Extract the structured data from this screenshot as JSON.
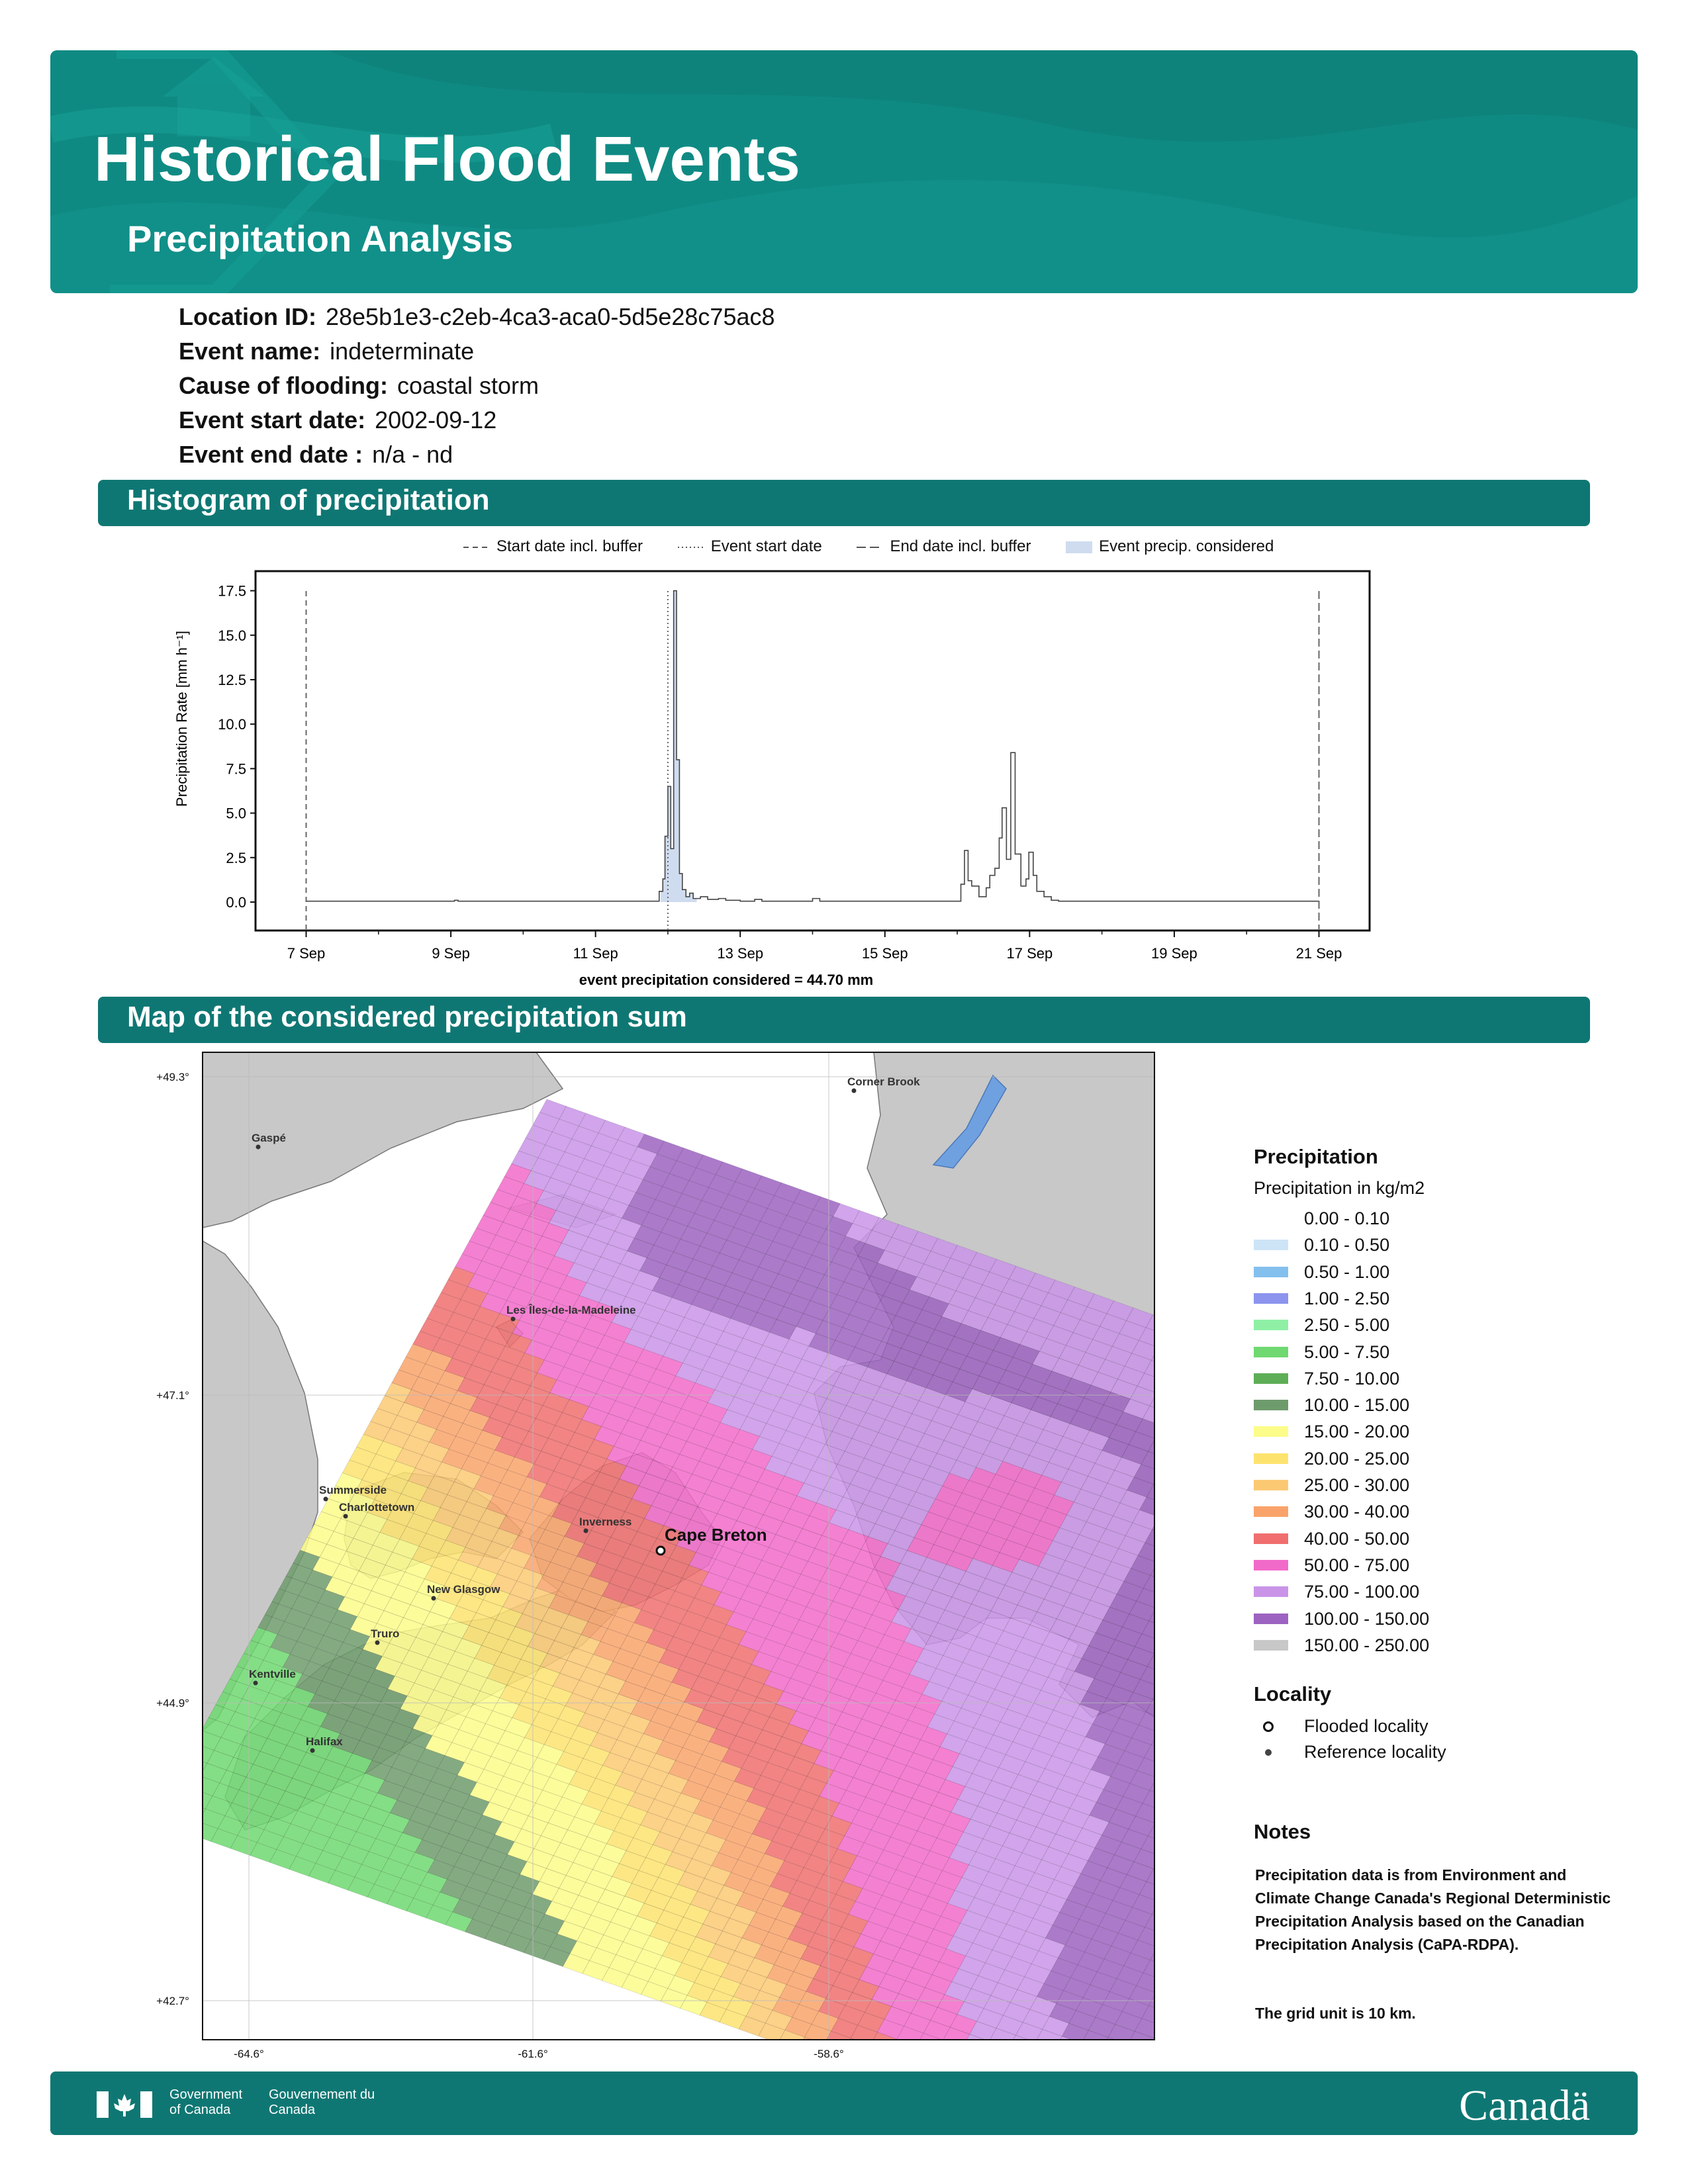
{
  "header": {
    "title": "Historical Flood Events",
    "subtitle": "Precipitation Analysis"
  },
  "info": [
    {
      "label": "Location ID:",
      "value": "28e5b1e3-c2eb-4ca3-aca0-5d5e28c75ac8"
    },
    {
      "label": "Event name:",
      "value": "indeterminate"
    },
    {
      "label": "Cause of flooding:",
      "value": "coastal storm"
    },
    {
      "label": "Event start date:",
      "value": "2002-09-12"
    },
    {
      "label": "Event end date :",
      "value": "n/a - nd"
    }
  ],
  "sections": {
    "histogram": "Histogram of precipitation",
    "map": "Map of the considered precipitation sum"
  },
  "histogram": {
    "legend": [
      "Start date incl. buffer",
      "Event start date",
      "End date incl. buffer",
      "Event precip. considered"
    ],
    "footnote": "event precipitation considered = 44.70 mm"
  },
  "chart_data": {
    "type": "line",
    "ylabel": "Precipitation Rate [mm h⁻¹]",
    "xlabel": "",
    "x_ticks": [
      "7 Sep",
      "9 Sep",
      "11 Sep",
      "13 Sep",
      "15 Sep",
      "17 Sep",
      "19 Sep",
      "21 Sep"
    ],
    "y_ticks": [
      "0.0",
      "2.5",
      "5.0",
      "7.5",
      "10.0",
      "12.5",
      "15.0",
      "17.5"
    ],
    "ylim": [
      -1.6,
      18.6
    ],
    "xlim_days": [
      6.3,
      21.7
    ],
    "start_buffer_day": 7.0,
    "event_start_day": 12.0,
    "end_buffer_day": 21.0,
    "considered_range_days": [
      11.9,
      12.4
    ],
    "series": [
      {
        "points": [
          [
            7.0,
            0.05
          ],
          [
            9.0,
            0.05
          ],
          [
            9.05,
            0.1
          ],
          [
            9.1,
            0.05
          ],
          [
            11.8,
            0.05
          ],
          [
            11.88,
            0.6
          ],
          [
            11.93,
            1.3
          ],
          [
            11.96,
            3.7
          ],
          [
            12.0,
            6.5
          ],
          [
            12.04,
            3.0
          ],
          [
            12.08,
            17.5
          ],
          [
            12.12,
            8.0
          ],
          [
            12.16,
            1.6
          ],
          [
            12.2,
            0.7
          ],
          [
            12.25,
            0.3
          ],
          [
            12.3,
            0.5
          ],
          [
            12.35,
            0.2
          ],
          [
            12.45,
            0.3
          ],
          [
            12.55,
            0.15
          ],
          [
            12.7,
            0.2
          ],
          [
            12.8,
            0.1
          ],
          [
            13.0,
            0.05
          ],
          [
            13.2,
            0.15
          ],
          [
            13.3,
            0.05
          ],
          [
            14.0,
            0.2
          ],
          [
            14.1,
            0.05
          ],
          [
            16.0,
            0.05
          ],
          [
            16.05,
            1.0
          ],
          [
            16.1,
            2.9
          ],
          [
            16.15,
            1.2
          ],
          [
            16.2,
            0.9
          ],
          [
            16.3,
            0.3
          ],
          [
            16.4,
            0.8
          ],
          [
            16.45,
            1.5
          ],
          [
            16.52,
            1.9
          ],
          [
            16.58,
            3.6
          ],
          [
            16.62,
            5.3
          ],
          [
            16.68,
            2.4
          ],
          [
            16.74,
            8.4
          ],
          [
            16.8,
            2.7
          ],
          [
            16.88,
            0.9
          ],
          [
            16.95,
            1.3
          ],
          [
            16.99,
            2.8
          ],
          [
            17.05,
            1.5
          ],
          [
            17.1,
            0.6
          ],
          [
            17.2,
            0.3
          ],
          [
            17.3,
            0.1
          ],
          [
            17.4,
            0.05
          ],
          [
            21.0,
            0.05
          ]
        ]
      }
    ]
  },
  "map": {
    "lat_ticks": [
      "+49.3°",
      "+47.1°",
      "+44.9°",
      "+42.7°"
    ],
    "lon_ticks": [
      "-64.6°",
      "-61.6°",
      "-58.6°"
    ],
    "cities": [
      "Gaspé",
      "Corner Brook",
      "Les Îles-de-la-Madeleine",
      "Summerside",
      "Charlottetown",
      "Inverness",
      "New Glasgow",
      "Truro",
      "Kentville",
      "Halifax"
    ],
    "flooded": "Cape Breton"
  },
  "map_legend": {
    "title": "Precipitation",
    "subtitle": "Precipitation in kg/m2",
    "bins": [
      {
        "label": "0.00 - 0.10",
        "color": "#ffffff"
      },
      {
        "label": "0.10 - 0.50",
        "color": "#cde4f7"
      },
      {
        "label": "0.50 - 1.00",
        "color": "#84c0ee"
      },
      {
        "label": "1.00 - 2.50",
        "color": "#8c94ee"
      },
      {
        "label": "2.50 - 5.00",
        "color": "#8ff0a5"
      },
      {
        "label": "5.00 - 7.50",
        "color": "#6fd870"
      },
      {
        "label": "7.50 - 10.00",
        "color": "#5eae57"
      },
      {
        "label": "10.00 - 15.00",
        "color": "#6e9b6c"
      },
      {
        "label": "15.00 - 20.00",
        "color": "#fcfc8a"
      },
      {
        "label": "20.00 - 25.00",
        "color": "#fde36e"
      },
      {
        "label": "25.00 - 30.00",
        "color": "#fcc973"
      },
      {
        "label": "30.00 - 40.00",
        "color": "#f9a36a"
      },
      {
        "label": "40.00 - 50.00",
        "color": "#f06e6e"
      },
      {
        "label": "50.00 - 75.00",
        "color": "#f26ac9"
      },
      {
        "label": "75.00 - 100.00",
        "color": "#c994e8"
      },
      {
        "label": "100.00 - 150.00",
        "color": "#9c63c0"
      },
      {
        "label": "150.00 - 250.00",
        "color": "#c8c8c8"
      }
    ],
    "locality_title": "Locality",
    "flooded_label": "Flooded locality",
    "reference_label": "Reference locality",
    "notes_title": "Notes",
    "notes_1": "Precipitation data is from Environment and Climate Change Canada's Regional Deterministic Precipitation Analysis based on the Canadian Precipitation Analysis (CaPA-RDPA).",
    "notes_2": "The grid unit is 10 km."
  },
  "footer": {
    "gov_en": "Government of Canada",
    "gov_fr": "Gouvernement du Canada",
    "wordmark": "Canadä"
  }
}
